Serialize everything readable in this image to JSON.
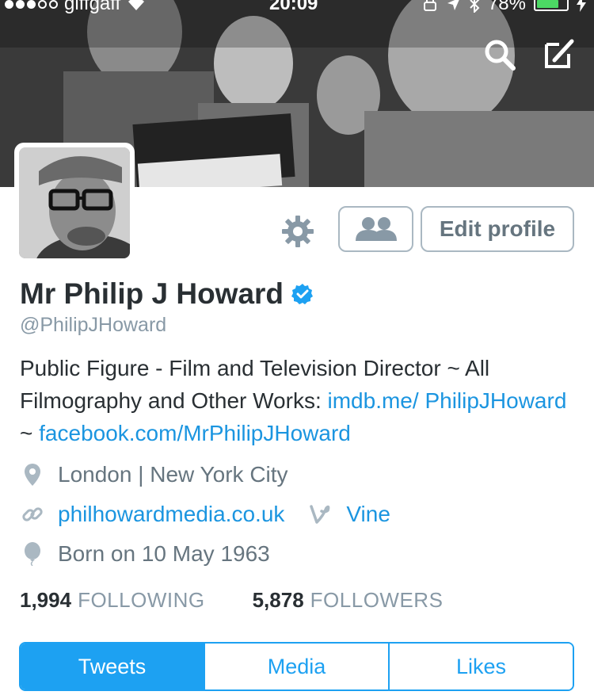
{
  "status_bar": {
    "carrier": "giffgaff",
    "time": "20:09",
    "battery_percent": "78%",
    "battery_level": 0.78,
    "signal_bars": 3
  },
  "header": {
    "icons": [
      "search-icon",
      "compose-icon"
    ]
  },
  "profile": {
    "name": "Mr Philip J Howard",
    "handle": "@PhilipJHoward",
    "verified": true,
    "bio_text_1": "Public Figure - Film and Television Director ~ All Filmography and Other Works: ",
    "bio_link_1": "imdb.me/ PhilipJHoward",
    "bio_sep": " ~ ",
    "bio_link_2": "facebook.com/MrPhilipJHoward",
    "location": "London | New York City",
    "website": "philhowardmedia.co.uk",
    "vine_label": "Vine",
    "born": "Born on 10 May 1963"
  },
  "actions": {
    "edit_profile": "Edit profile"
  },
  "stats": {
    "following_count": "1,994",
    "following_label": "FOLLOWING",
    "followers_count": "5,878",
    "followers_label": "FOLLOWERS"
  },
  "tabs": [
    {
      "label": "Tweets",
      "active": true
    },
    {
      "label": "Media",
      "active": false
    },
    {
      "label": "Likes",
      "active": false
    }
  ],
  "colors": {
    "accent": "#1da1f2",
    "link": "#1b95e0",
    "muted": "#8899a6",
    "text": "#292f33",
    "battery": "#4cd964"
  }
}
